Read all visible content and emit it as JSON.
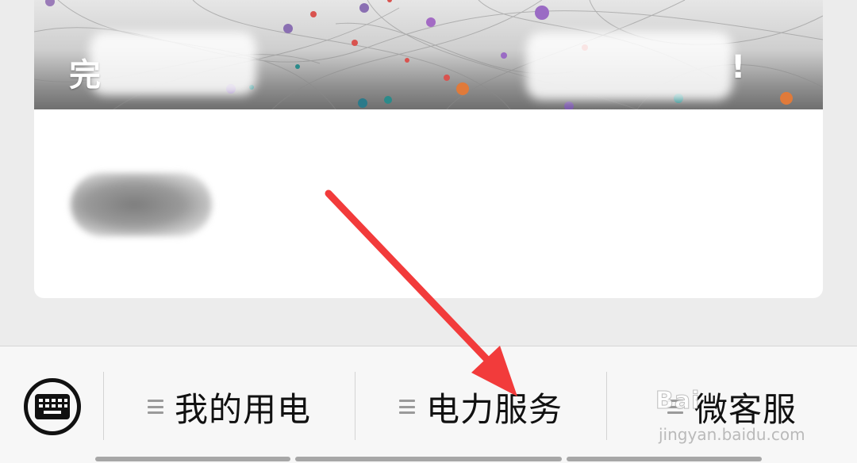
{
  "article": {
    "banner_title": "完",
    "banner_title_tail": "!"
  },
  "menu": {
    "keyboard_icon": "keyboard-icon",
    "items": [
      {
        "label": "我的用电",
        "icon": "menu-lines-icon"
      },
      {
        "label": "电力服务",
        "icon": "menu-lines-icon"
      },
      {
        "label": "微客服",
        "icon": "menu-lines-icon"
      }
    ]
  },
  "watermark": {
    "brand": "Bai",
    "url": "jingyan.baidu.com"
  },
  "annotation": {
    "arrow_color": "#f23b3b"
  }
}
